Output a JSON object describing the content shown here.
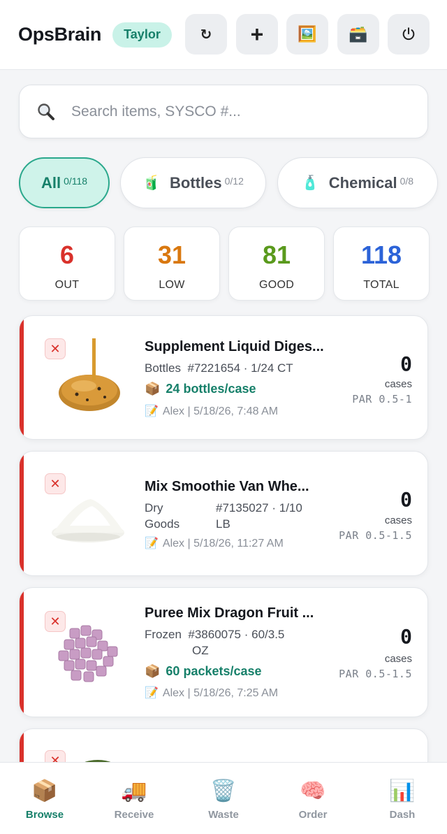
{
  "header": {
    "brand": "OpsBrain",
    "user": "Taylor",
    "buttons": {
      "refresh": "↻",
      "add": "+",
      "image": "🖼️",
      "card": "🗃️"
    }
  },
  "search": {
    "placeholder": "Search items, SYSCO #..."
  },
  "categories": [
    {
      "label": "All",
      "count": "0/118",
      "icon": ""
    },
    {
      "label": "Bottles",
      "count": "0/12",
      "icon": "🧃"
    },
    {
      "label": "Chemical",
      "count": "0/8",
      "icon": "🧴"
    }
  ],
  "stats": [
    {
      "value": "6",
      "label": "OUT",
      "color": "#d9312b"
    },
    {
      "value": "31",
      "label": "LOW",
      "color": "#d9780f"
    },
    {
      "value": "81",
      "label": "GOOD",
      "color": "#5a9a1d"
    },
    {
      "value": "118",
      "label": "TOTAL",
      "color": "#2c63d8"
    }
  ],
  "items": [
    {
      "title": "Supplement Liquid Diges...",
      "category": "Bottles",
      "sku": "#7221654 · 1/24 CT",
      "pack": "24 bottles/case",
      "note": "Alex | 5/18/26, 7:48 AM",
      "qty": "0",
      "unit": "cases",
      "par": "PAR 0.5-1"
    },
    {
      "title": "Mix Smoothie Van Whe...",
      "category_line1": "Dry",
      "category_line2": "Goods",
      "sku_line1": "#7135027 · 1/10",
      "sku_line2": "LB",
      "note": "Alex | 5/18/26, 11:27 AM",
      "qty": "0",
      "unit": "cases",
      "par": "PAR 0.5-1.5"
    },
    {
      "title": "Puree Mix Dragon Fruit ...",
      "category": "Frozen",
      "sku_line1": "#3860075 · 60/3.5",
      "sku_line2": "OZ",
      "pack": "60 packets/case",
      "note": "Alex | 5/18/26, 7:25 AM",
      "qty": "0",
      "unit": "cases",
      "par": "PAR 0.5-1.5"
    }
  ],
  "remove_symbol": "✕",
  "pack_icon": "📦",
  "note_icon": "📝",
  "nav": [
    {
      "label": "Browse",
      "icon": "📦",
      "active": true
    },
    {
      "label": "Receive",
      "icon": "🚚",
      "active": false
    },
    {
      "label": "Waste",
      "icon": "🗑️",
      "active": false
    },
    {
      "label": "Order",
      "icon": "🧠",
      "active": false
    },
    {
      "label": "Dash",
      "icon": "📊",
      "active": false
    }
  ]
}
